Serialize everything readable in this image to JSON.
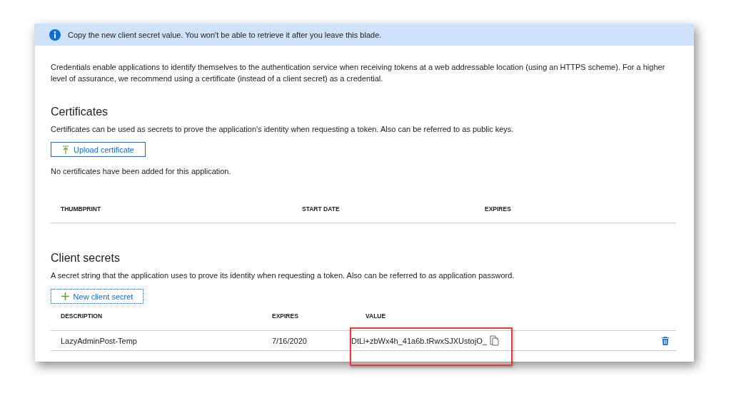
{
  "banner": {
    "text": "Copy the new client secret value. You won't be able to retrieve it after you leave this blade."
  },
  "intro": "Credentials enable applications to identify themselves to the authentication service when receiving tokens at a web addressable location (using an HTTPS scheme). For a higher level of assurance, we recommend using a certificate (instead of a client secret) as a credential.",
  "certificates": {
    "title": "Certificates",
    "description": "Certificates can be used as secrets to prove the application's identity when requesting a token. Also can be referred to as public keys.",
    "button": "Upload certificate",
    "empty_message": "No certificates have been added for this application.",
    "columns": [
      "THUMBPRINT",
      "START DATE",
      "EXPIRES"
    ]
  },
  "client_secrets": {
    "title": "Client secrets",
    "description": "A secret string that the application uses to prove its identity when requesting a token. Also can be referred to as application password.",
    "button": "New client secret",
    "columns": [
      "DESCRIPTION",
      "EXPIRES",
      "VALUE"
    ],
    "rows": [
      {
        "description": "LazyAdminPost-Temp",
        "expires": "7/16/2020",
        "value": "DtLi+zbWx4h_41a6b.tRwxSJXUstojO_",
        "highlighted": true
      }
    ]
  }
}
